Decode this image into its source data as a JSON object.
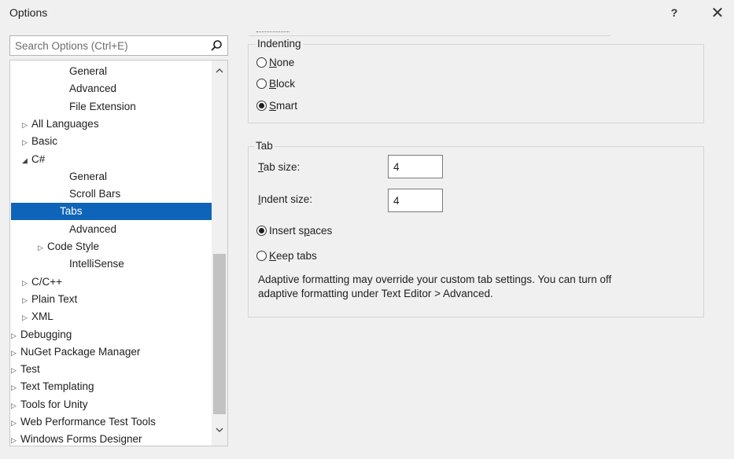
{
  "window": {
    "title": "Options",
    "help_label": "?",
    "close_label": "✕"
  },
  "search": {
    "placeholder": "Search Options (Ctrl+E)",
    "value": "",
    "icon": "search-icon"
  },
  "tree": {
    "items": [
      {
        "label": "General",
        "expander": ""
      },
      {
        "label": "Advanced",
        "expander": ""
      },
      {
        "label": "File Extension",
        "expander": ""
      },
      {
        "label": "All Languages",
        "expander": "▷"
      },
      {
        "label": "Basic",
        "expander": "▷"
      },
      {
        "label": "C#",
        "expander": "◢"
      },
      {
        "label": "General",
        "expander": ""
      },
      {
        "label": "Scroll Bars",
        "expander": ""
      },
      {
        "label": "Tabs",
        "expander": ""
      },
      {
        "label": "Advanced",
        "expander": ""
      },
      {
        "label": "Code Style",
        "expander": "▷"
      },
      {
        "label": "IntelliSense",
        "expander": ""
      },
      {
        "label": "C/C++",
        "expander": "▷"
      },
      {
        "label": "Plain Text",
        "expander": "▷"
      },
      {
        "label": "XML",
        "expander": "▷"
      },
      {
        "label": "Debugging",
        "expander": "▷"
      },
      {
        "label": "NuGet Package Manager",
        "expander": "▷"
      },
      {
        "label": "Test",
        "expander": "▷"
      },
      {
        "label": "Text Templating",
        "expander": "▷"
      },
      {
        "label": "Tools for Unity",
        "expander": "▷"
      },
      {
        "label": "Web Performance Test Tools",
        "expander": "▷"
      },
      {
        "label": "Windows Forms Designer",
        "expander": "▷"
      }
    ],
    "selected_label": "Tabs"
  },
  "indenting": {
    "title": "Indenting",
    "options": [
      {
        "key": "N",
        "rest": "one",
        "checked": false
      },
      {
        "key": "B",
        "rest": "lock",
        "checked": false
      },
      {
        "key": "S",
        "rest": "mart",
        "checked": true
      }
    ]
  },
  "tab": {
    "title": "Tab",
    "tab_size_key": "T",
    "tab_size_rest": "ab size:",
    "tab_size_value": "4",
    "indent_size_key": "I",
    "indent_size_rest": "ndent size:",
    "indent_size_value": "4",
    "insert_spaces_before": "Insert s",
    "insert_spaces_key": "p",
    "insert_spaces_after": "aces",
    "insert_spaces_checked": true,
    "keep_tabs_key": "K",
    "keep_tabs_rest": "eep tabs",
    "keep_tabs_checked": false,
    "info_line1": "Adaptive formatting may override your custom tab settings. You can turn off",
    "info_line2": "adaptive formatting under Text Editor > Advanced."
  },
  "colors": {
    "selection": "#0e64b8",
    "background": "#f0f0f0"
  }
}
